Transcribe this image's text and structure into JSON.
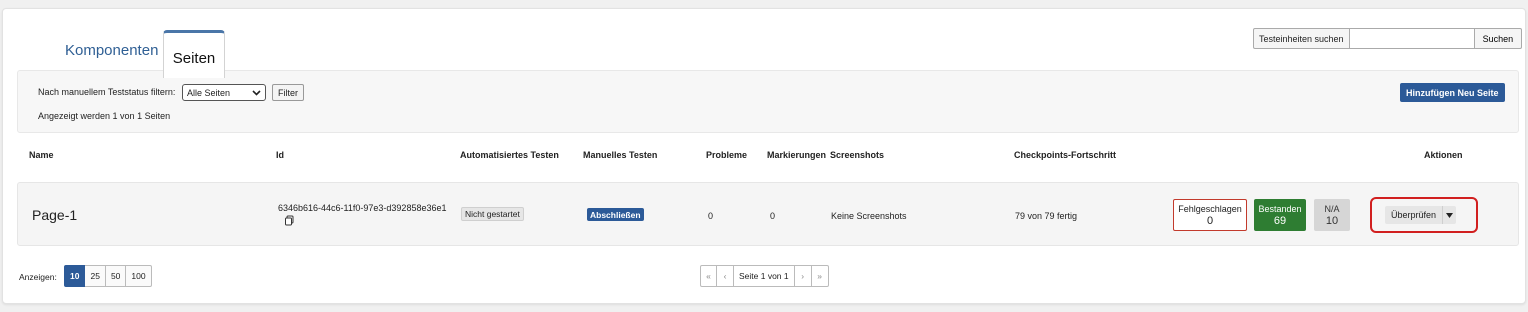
{
  "tabs": [
    {
      "label": "Komponenten"
    },
    {
      "label": "Seiten"
    }
  ],
  "search": {
    "label": "Testeinheiten suchen",
    "value": "",
    "placeholder": "",
    "button": "Suchen"
  },
  "filter": {
    "label": "Nach manuellem Teststatus filtern:",
    "selected": "Alle Seiten",
    "button": "Filter",
    "shown": "Angezeigt werden 1 von 1 Seiten",
    "add_button": "Hinzufügen Neu Seite"
  },
  "table": {
    "headers": {
      "name": "Name",
      "id": "Id",
      "auto": "Automatisiertes Testen",
      "manual": "Manuelles Testen",
      "problems": "Probleme",
      "marks": "Markierungen",
      "screenshots": "Screenshots",
      "progress": "Checkpoints-Fortschritt",
      "actions": "Aktionen"
    },
    "rows": [
      {
        "name": "Page-1",
        "id": "6346b616-44c6-11f0-97e3-d392858e36e1",
        "auto": "Nicht gestartet",
        "manual": "Abschließen",
        "problems": "0",
        "marks": "0",
        "screenshots": "Keine Screenshots",
        "progress": "79 von 79 fertig",
        "failed_label": "Fehlgeschlagen",
        "failed_count": "0",
        "passed_label": "Bestanden",
        "passed_count": "69",
        "na_label": "N/A",
        "na_count": "10",
        "review_button": "Überprüfen"
      }
    ]
  },
  "footer": {
    "show_label": "Anzeigen:",
    "page_sizes": [
      "10",
      "25",
      "50",
      "100"
    ],
    "pager": {
      "first": "«",
      "prev": "‹",
      "current": "Seite 1 von 1",
      "next": "›",
      "last": "»"
    }
  },
  "colors": {
    "primary": "#2c5a98",
    "passed": "#2e7d32",
    "failed_border": "#c23a2c",
    "highlight": "#d11f1f"
  }
}
